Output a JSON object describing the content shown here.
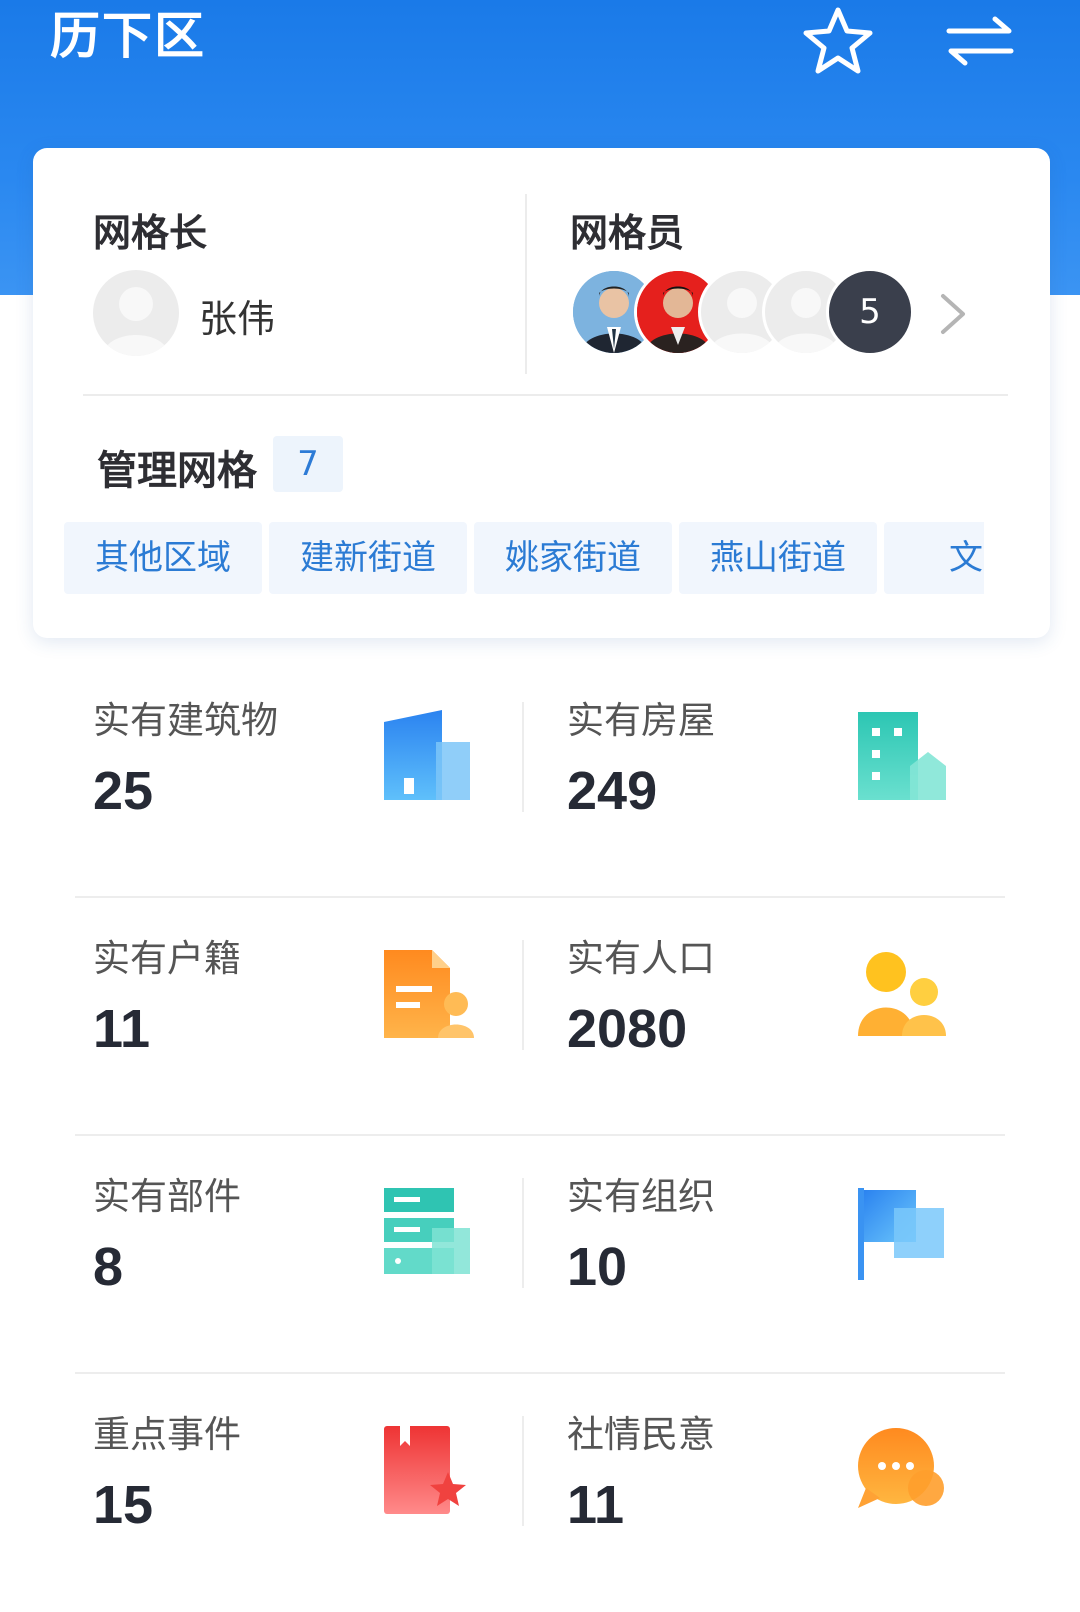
{
  "header": {
    "title": "历下区",
    "star_icon": "star-outline-icon",
    "switch_icon": "switch-arrows-icon"
  },
  "card": {
    "leader": {
      "label": "网格长",
      "name": "张伟"
    },
    "members": {
      "label": "网格员",
      "more_count": "5"
    },
    "grids": {
      "label": "管理网格",
      "count": "7",
      "items": [
        "其他区域",
        "建新街道",
        "姚家街道",
        "燕山街道",
        "文东"
      ]
    }
  },
  "stats": [
    {
      "left": {
        "label": "实有建筑物",
        "value": "25"
      },
      "right": {
        "label": "实有房屋",
        "value": "249"
      }
    },
    {
      "left": {
        "label": "实有户籍",
        "value": "11"
      },
      "right": {
        "label": "实有人口",
        "value": "2080"
      }
    },
    {
      "left": {
        "label": "实有部件",
        "value": "8"
      },
      "right": {
        "label": "实有组织",
        "value": "10"
      }
    },
    {
      "left": {
        "label": "重点事件",
        "value": "15"
      },
      "right": {
        "label": "社情民意",
        "value": "11"
      }
    }
  ],
  "colors": {
    "header_blue": "#1a7ae8",
    "chip_text": "#2b7bd4",
    "value_text": "#262a35"
  }
}
